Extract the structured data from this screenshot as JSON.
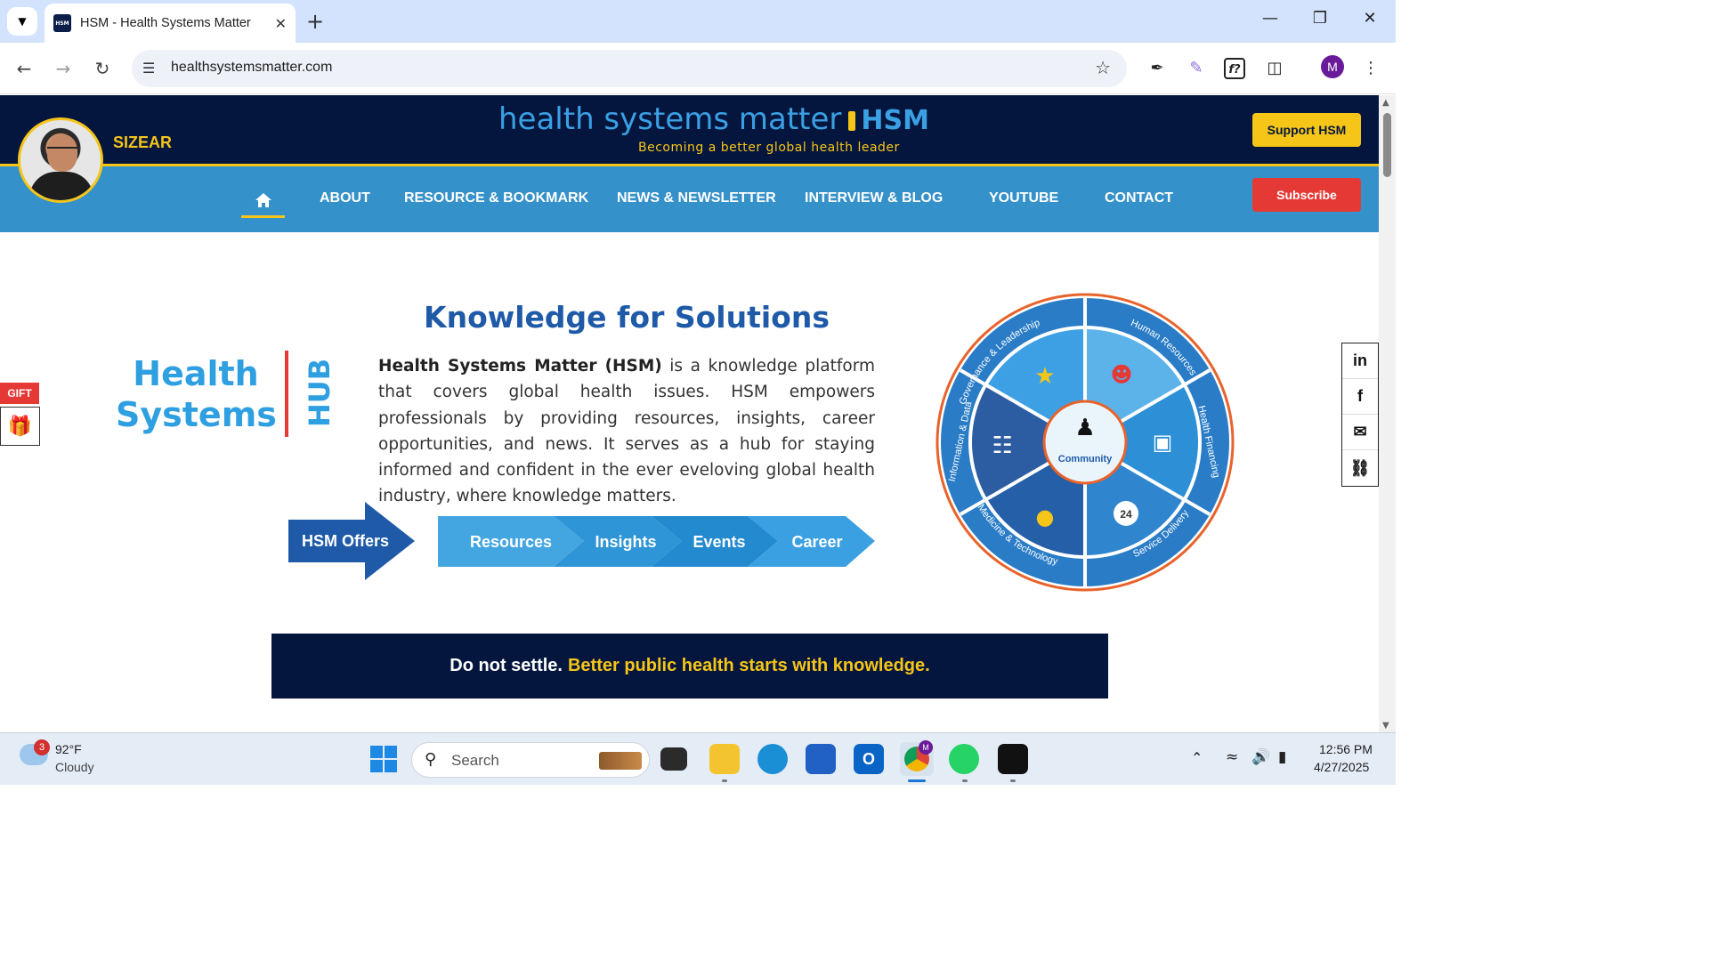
{
  "browser": {
    "tab_title": "HSM - Health Systems Matter",
    "favicon_text": "HSM",
    "url": "healthsystemsmatter.com",
    "profile_initial": "M"
  },
  "site": {
    "username": "SIZEAR",
    "brand": "health systems matter",
    "brand_abbr": "HSM",
    "tagline": "Becoming a better global health leader",
    "support_label": "Support HSM",
    "subscribe_label": "Subscribe",
    "nav": [
      "ABOUT",
      "RESOURCE & BOOKMARK",
      "NEWS & NEWSLETTER",
      "INTERVIEW & BLOG",
      "YOUTUBE",
      "CONTACT"
    ]
  },
  "main": {
    "heading": "Knowledge for Solutions",
    "hs_line1": "Health",
    "hs_line2": "Systems",
    "hub": "HUB",
    "intro_bold": "Health Systems Matter (HSM)",
    "intro_rest": " is a knowledge platform that covers global health issues. HSM empowers professionals by providing resources, insights, career opportunities, and news. It serves as a hub for staying informed and confident in the ever eveloving global health industry, where knowledge matters.",
    "offers_label": "HSM Offers",
    "offers": [
      "Resources",
      "Insights",
      "Events",
      "Career"
    ],
    "banner_white": "Do not settle.",
    "banner_yellow": "Better public health starts with knowledge."
  },
  "wheel": {
    "center": "Community",
    "segments": [
      "Governance & Leadership",
      "Human Resources",
      "Health Financing",
      "Service Delivery",
      "Medicine & Technology",
      "Information & Data"
    ],
    "badge_24": "24"
  },
  "side": {
    "gift_label": "GIFT",
    "share": [
      "in",
      "f",
      "✉",
      "⛓"
    ]
  },
  "taskbar": {
    "weather_badge": "3",
    "temperature": "92°F",
    "condition": "Cloudy",
    "search_placeholder": "Search",
    "time": "12:56 PM",
    "date": "4/27/2025",
    "outlook_letter": "O",
    "chrome_badge": "M"
  },
  "colors": {
    "header_navy": "#05163e",
    "nav_blue": "#3591c9",
    "accent_yellow": "#f5c518",
    "subscribe_red": "#e53935",
    "heading_blue": "#1e5aa8"
  }
}
